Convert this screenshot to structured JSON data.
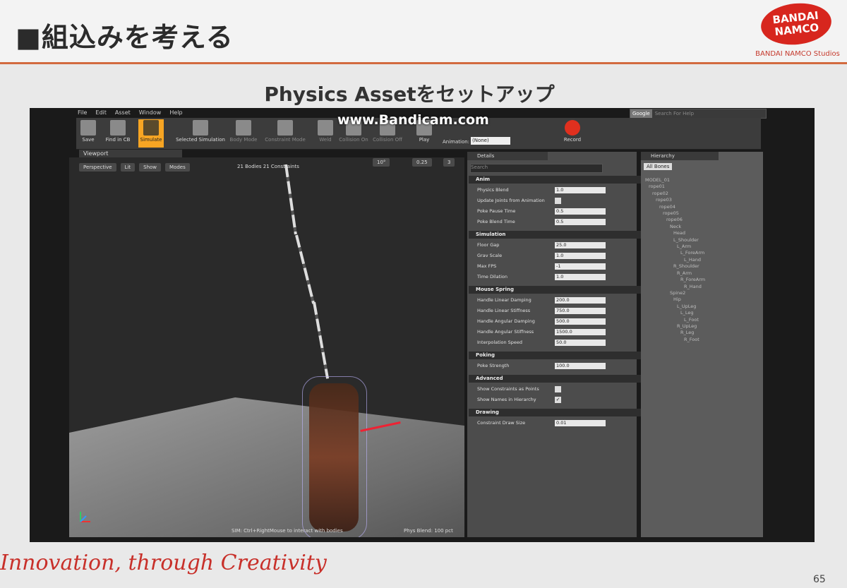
{
  "slide": {
    "title": "■組込みを考える",
    "subtitle": "Physics Assetをセットアップ",
    "brand_logo": "BANDAI NAMCO",
    "brand_sub": "BANDAI NAMCO Studios",
    "tagline": "Innovation, through Creativity",
    "page_number": "65",
    "accent_color": "#d26a3f"
  },
  "editor": {
    "watermark": "www.Bandicam.com",
    "menu": [
      "File",
      "Edit",
      "Asset",
      "Window",
      "Help"
    ],
    "search_engine": "Google",
    "search_placeholder": "Search For Help",
    "toolbar": [
      {
        "label": "Save",
        "icon": "save-icon",
        "state": "normal"
      },
      {
        "label": "Find in CB",
        "icon": "find-icon",
        "state": "normal"
      },
      {
        "label": "Simulate",
        "icon": "simulate-icon",
        "state": "active"
      },
      {
        "label": "Selected Simulation",
        "icon": "selected-simulation-icon",
        "state": "normal"
      },
      {
        "label": "Body Mode",
        "icon": "body-mode-icon",
        "state": "disabled"
      },
      {
        "label": "Constraint Mode",
        "icon": "constraint-mode-icon",
        "state": "disabled"
      },
      {
        "label": "Weld",
        "icon": "weld-icon",
        "state": "disabled"
      },
      {
        "label": "Collision On",
        "icon": "collision-on-icon",
        "state": "disabled"
      },
      {
        "label": "Collision Off",
        "icon": "collision-off-icon",
        "state": "disabled"
      },
      {
        "label": "Play",
        "icon": "play-icon",
        "state": "normal"
      },
      {
        "label": "Record",
        "icon": "record-icon",
        "state": "normal"
      }
    ],
    "animation_label": "Animation:",
    "animation_value": "(None)",
    "viewport": {
      "tab": "Viewport",
      "buttons": [
        "Perspective",
        "Lit",
        "Show",
        "Modes"
      ],
      "info": "21 Bodies  21 Constraints",
      "snap_rotation": "10°",
      "snap_scale": "0.25",
      "camera_speed": "3",
      "hint": "SIM: Ctrl+RightMouse to interact with bodies",
      "phys_blend": "Phys Blend: 100 pct"
    },
    "details": {
      "tab": "Details",
      "search_placeholder": "Search",
      "sections": [
        {
          "title": "Anim",
          "rows": [
            {
              "label": "Physics Blend",
              "value": "1.0"
            },
            {
              "label": "Update Joints from Animation",
              "check": ""
            },
            {
              "label": "Poke Pause Time",
              "value": "0.5"
            },
            {
              "label": "Poke Blend Time",
              "value": "0.5"
            }
          ]
        },
        {
          "title": "Simulation",
          "rows": [
            {
              "label": "Floor Gap",
              "value": "25.0"
            },
            {
              "label": "Grav Scale",
              "value": "1.0"
            },
            {
              "label": "Max FPS",
              "value": "-1"
            },
            {
              "label": "Time Dilation",
              "value": "1.0"
            }
          ]
        },
        {
          "title": "Mouse Spring",
          "rows": [
            {
              "label": "Handle Linear Damping",
              "value": "200.0"
            },
            {
              "label": "Handle Linear Stiffness",
              "value": "750.0"
            },
            {
              "label": "Handle Angular Damping",
              "value": "500.0"
            },
            {
              "label": "Handle Angular Stiffness",
              "value": "1500.0"
            },
            {
              "label": "Interpolation Speed",
              "value": "50.0"
            }
          ]
        },
        {
          "title": "Poking",
          "rows": [
            {
              "label": "Poke Strength",
              "value": "100.0"
            }
          ]
        },
        {
          "title": "Advanced",
          "rows": [
            {
              "label": "Show Constraints as Points",
              "check": ""
            },
            {
              "label": "Show Names in Hierarchy",
              "check": "✓"
            }
          ]
        },
        {
          "title": "Drawing",
          "rows": [
            {
              "label": "Constraint Draw Size",
              "value": "0.01"
            }
          ]
        }
      ]
    },
    "hierarchy": {
      "tab": "Hierarchy",
      "filter": "All Bones",
      "bones": [
        "MODEL_01",
        "rope01",
        "rope02",
        "rope03",
        "rope04",
        "rope05",
        "rope06",
        "Neck",
        "Head",
        "L_Shoulder",
        "L_Arm",
        "L_ForeArm",
        "L_Hand",
        "R_Shoulder",
        "R_Arm",
        "R_ForeArm",
        "R_Hand",
        "Spine2",
        "Hip",
        "L_UpLeg",
        "L_Leg",
        "L_Foot",
        "R_UpLeg",
        "R_Leg",
        "R_Foot"
      ]
    }
  }
}
